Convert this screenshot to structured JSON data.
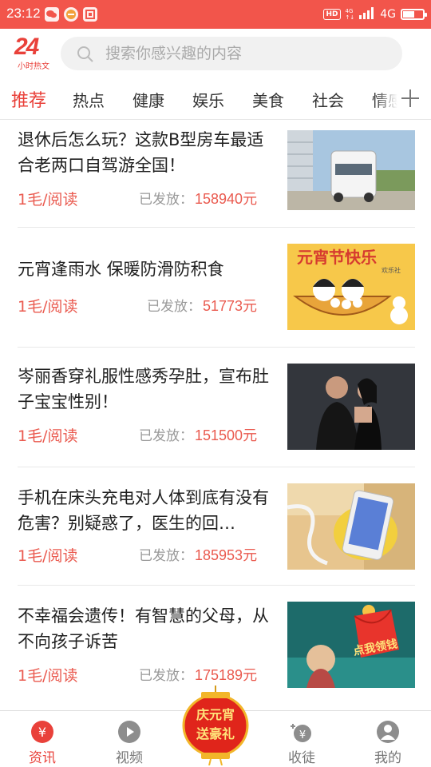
{
  "status_bar": {
    "time": "23:12",
    "hd": "HD",
    "network": "4G",
    "network_small_top": "4G",
    "network_small_bottom": "↑↓",
    "battery_level": 0.6,
    "icons": [
      "wechat-icon",
      "cat-app-icon",
      "qr-scan-icon"
    ]
  },
  "header": {
    "logo_number": "24",
    "logo_text": "小时热文",
    "search_placeholder": "搜索你感兴趣的内容"
  },
  "tabs": [
    "推荐",
    "热点",
    "健康",
    "娱乐",
    "美食",
    "社会",
    "情感"
  ],
  "active_tab": 0,
  "colors": {
    "accent": "#e9413a",
    "status_bar": "#f2554b",
    "price": "#ea5a4f"
  },
  "articles": [
    {
      "title": "退休后怎么玩？这款B型房车最适合老两口自驾游全国！",
      "price": "1毛/阅读",
      "paid_label": "已发放：",
      "paid_amount": "158940元",
      "thumb": "white-camper-van-photo"
    },
    {
      "title": "元宵逢雨水 保暖防滑防积食",
      "price": "1毛/阅读",
      "paid_label": "已发放：",
      "paid_amount": "51773元",
      "thumb": "lantern-festival-cartoon",
      "thumb_caption": "元宵节快乐",
      "thumb_caption_small": "欢乐社"
    },
    {
      "title": "岑丽香穿礼服性感秀孕肚，宣布肚子宝宝性别！",
      "price": "1毛/阅读",
      "paid_label": "已发放：",
      "paid_amount": "151500元",
      "thumb": "couple-photo"
    },
    {
      "title": "手机在床头充电对人体到底有没有危害？别疑惑了，医生的回…",
      "price": "1毛/阅读",
      "paid_label": "已发放：",
      "paid_amount": "185953元",
      "thumb": "phone-charging-photo"
    },
    {
      "title": "不幸福会遗传！有智慧的父母，从不向孩子诉苦",
      "price": "1毛/阅读",
      "paid_label": "已发放：",
      "paid_amount": "175189元",
      "thumb": "red-envelope-ad",
      "thumb_caption": "点我领钱"
    }
  ],
  "bottom_nav": [
    {
      "label": "资讯",
      "icon": "yuan-coin-icon",
      "active": true
    },
    {
      "label": "视频",
      "icon": "play-circle-icon",
      "active": false
    },
    {
      "label": "收徒",
      "icon": "apprentice-icon",
      "active": false
    },
    {
      "label": "我的",
      "icon": "profile-icon",
      "active": false
    }
  ],
  "promo": {
    "line1": "庆元宵",
    "line2": "送豪礼"
  }
}
